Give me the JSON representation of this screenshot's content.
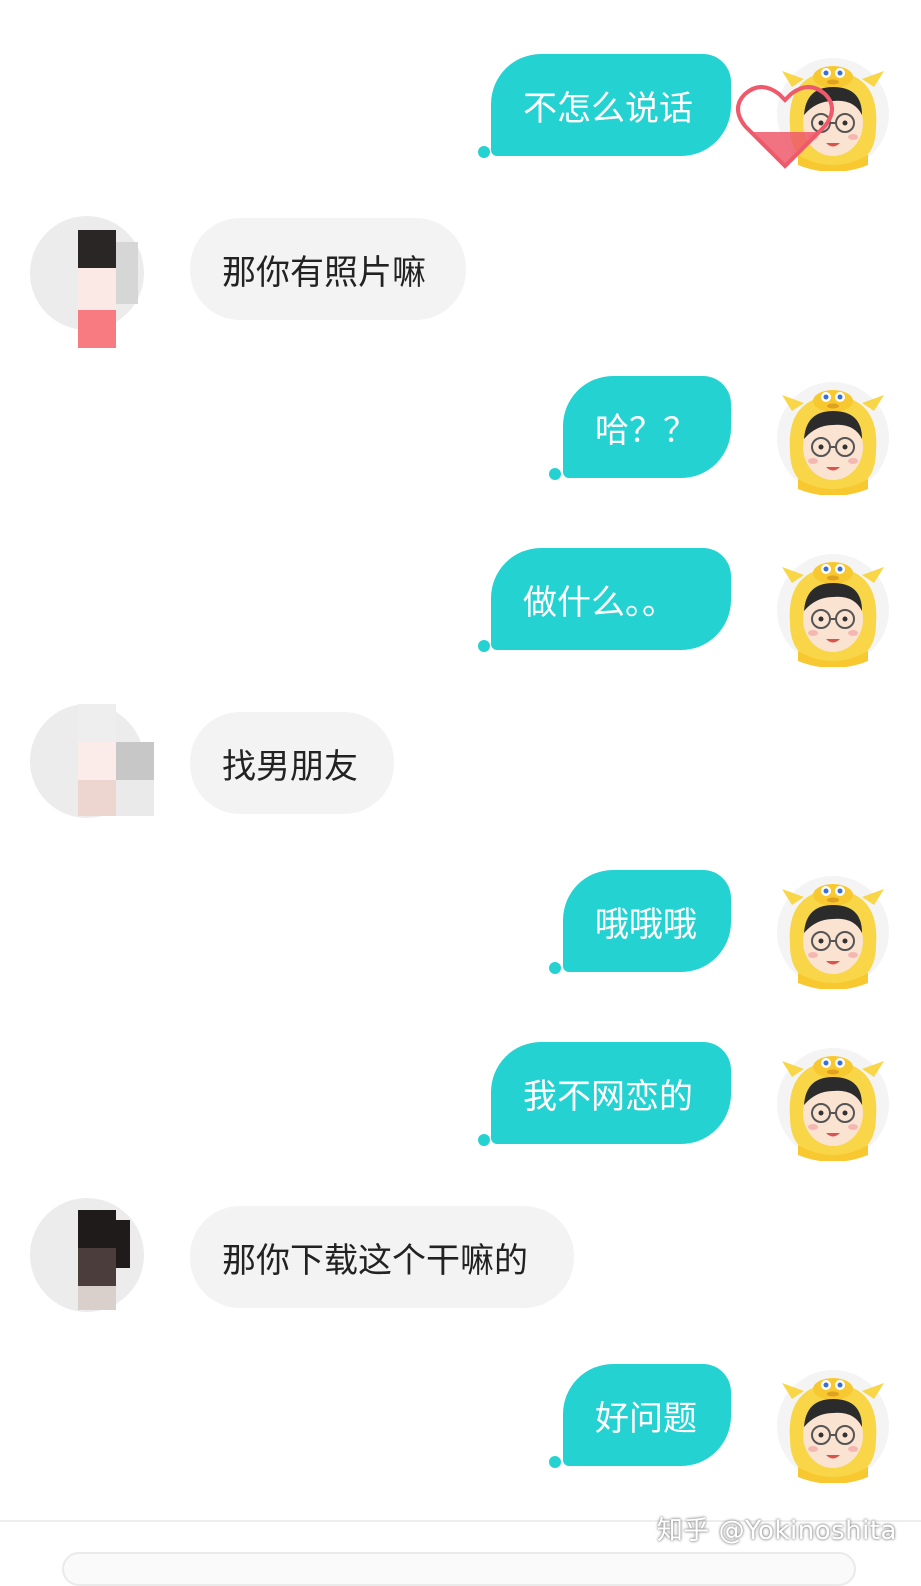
{
  "messages": [
    {
      "side": "out",
      "text": "不怎么说话"
    },
    {
      "side": "in",
      "text": "那你有照片嘛"
    },
    {
      "side": "out",
      "text": "哈？？"
    },
    {
      "side": "out",
      "text": "做什么。。"
    },
    {
      "side": "in",
      "text": "找男朋友"
    },
    {
      "side": "out",
      "text": "哦哦哦"
    },
    {
      "side": "out",
      "text": "我不网恋的"
    },
    {
      "side": "in",
      "text": "那你下载这个干嘛的"
    },
    {
      "side": "out",
      "text": "好问题"
    }
  ],
  "watermark": "知乎 @Yokinoshita",
  "colors": {
    "outgoing_bubble": "#25d2d2",
    "incoming_bubble": "#f3f3f3",
    "outgoing_text": "#ffffff",
    "incoming_text": "#222222"
  },
  "icons": {
    "self_avatar": "cartoon-boy-in-yellow-dinosaur-hood-icon",
    "other_avatar": "pixelated-avatar-icon",
    "frame_decoration": "heart-frame-icon"
  }
}
